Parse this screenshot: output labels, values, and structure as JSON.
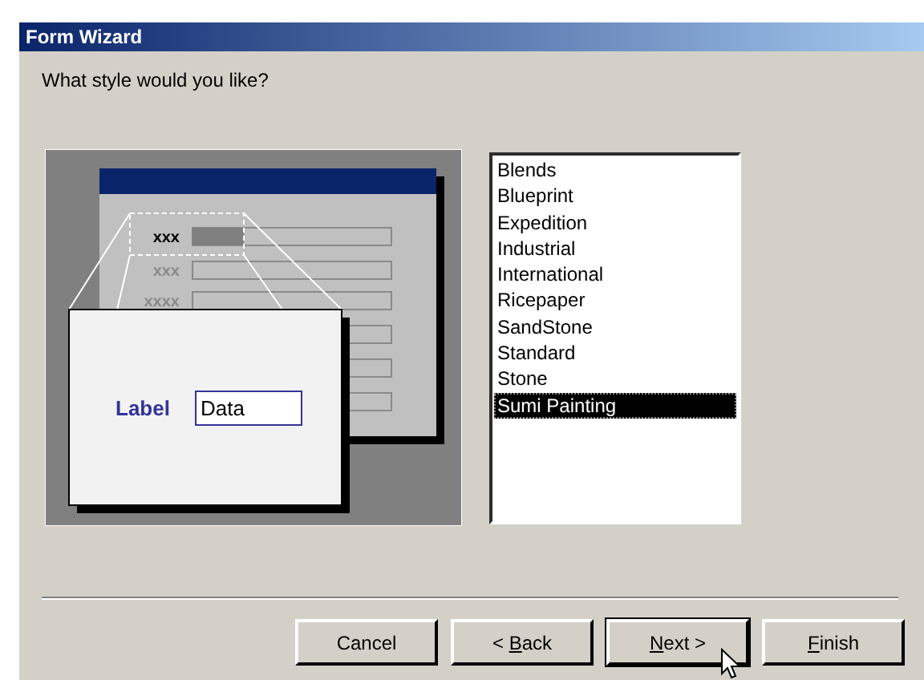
{
  "window": {
    "title": "Form Wizard"
  },
  "prompt": "What style would you like?",
  "preview": {
    "rows": [
      {
        "label": "xxx",
        "emphasized": true
      },
      {
        "label": "xxx",
        "emphasized": false
      },
      {
        "label": "xxxx",
        "emphasized": false
      }
    ],
    "callout_label": "Label",
    "callout_value": "Data"
  },
  "styles": [
    {
      "label": "Blends",
      "selected": false
    },
    {
      "label": "Blueprint",
      "selected": false
    },
    {
      "label": "Expedition",
      "selected": false
    },
    {
      "label": "Industrial",
      "selected": false
    },
    {
      "label": "International",
      "selected": false
    },
    {
      "label": "Ricepaper",
      "selected": false
    },
    {
      "label": "SandStone",
      "selected": false
    },
    {
      "label": "Standard",
      "selected": false
    },
    {
      "label": "Stone",
      "selected": false
    },
    {
      "label": "Sumi Painting",
      "selected": true
    }
  ],
  "buttons": [
    {
      "before": "Cancel",
      "default": false
    },
    {
      "before": "< ",
      "key": "B",
      "after": "ack",
      "default": false
    },
    {
      "key": "N",
      "after": "ext >",
      "default": true
    },
    {
      "key": "F",
      "after": "inish",
      "default": false
    }
  ]
}
